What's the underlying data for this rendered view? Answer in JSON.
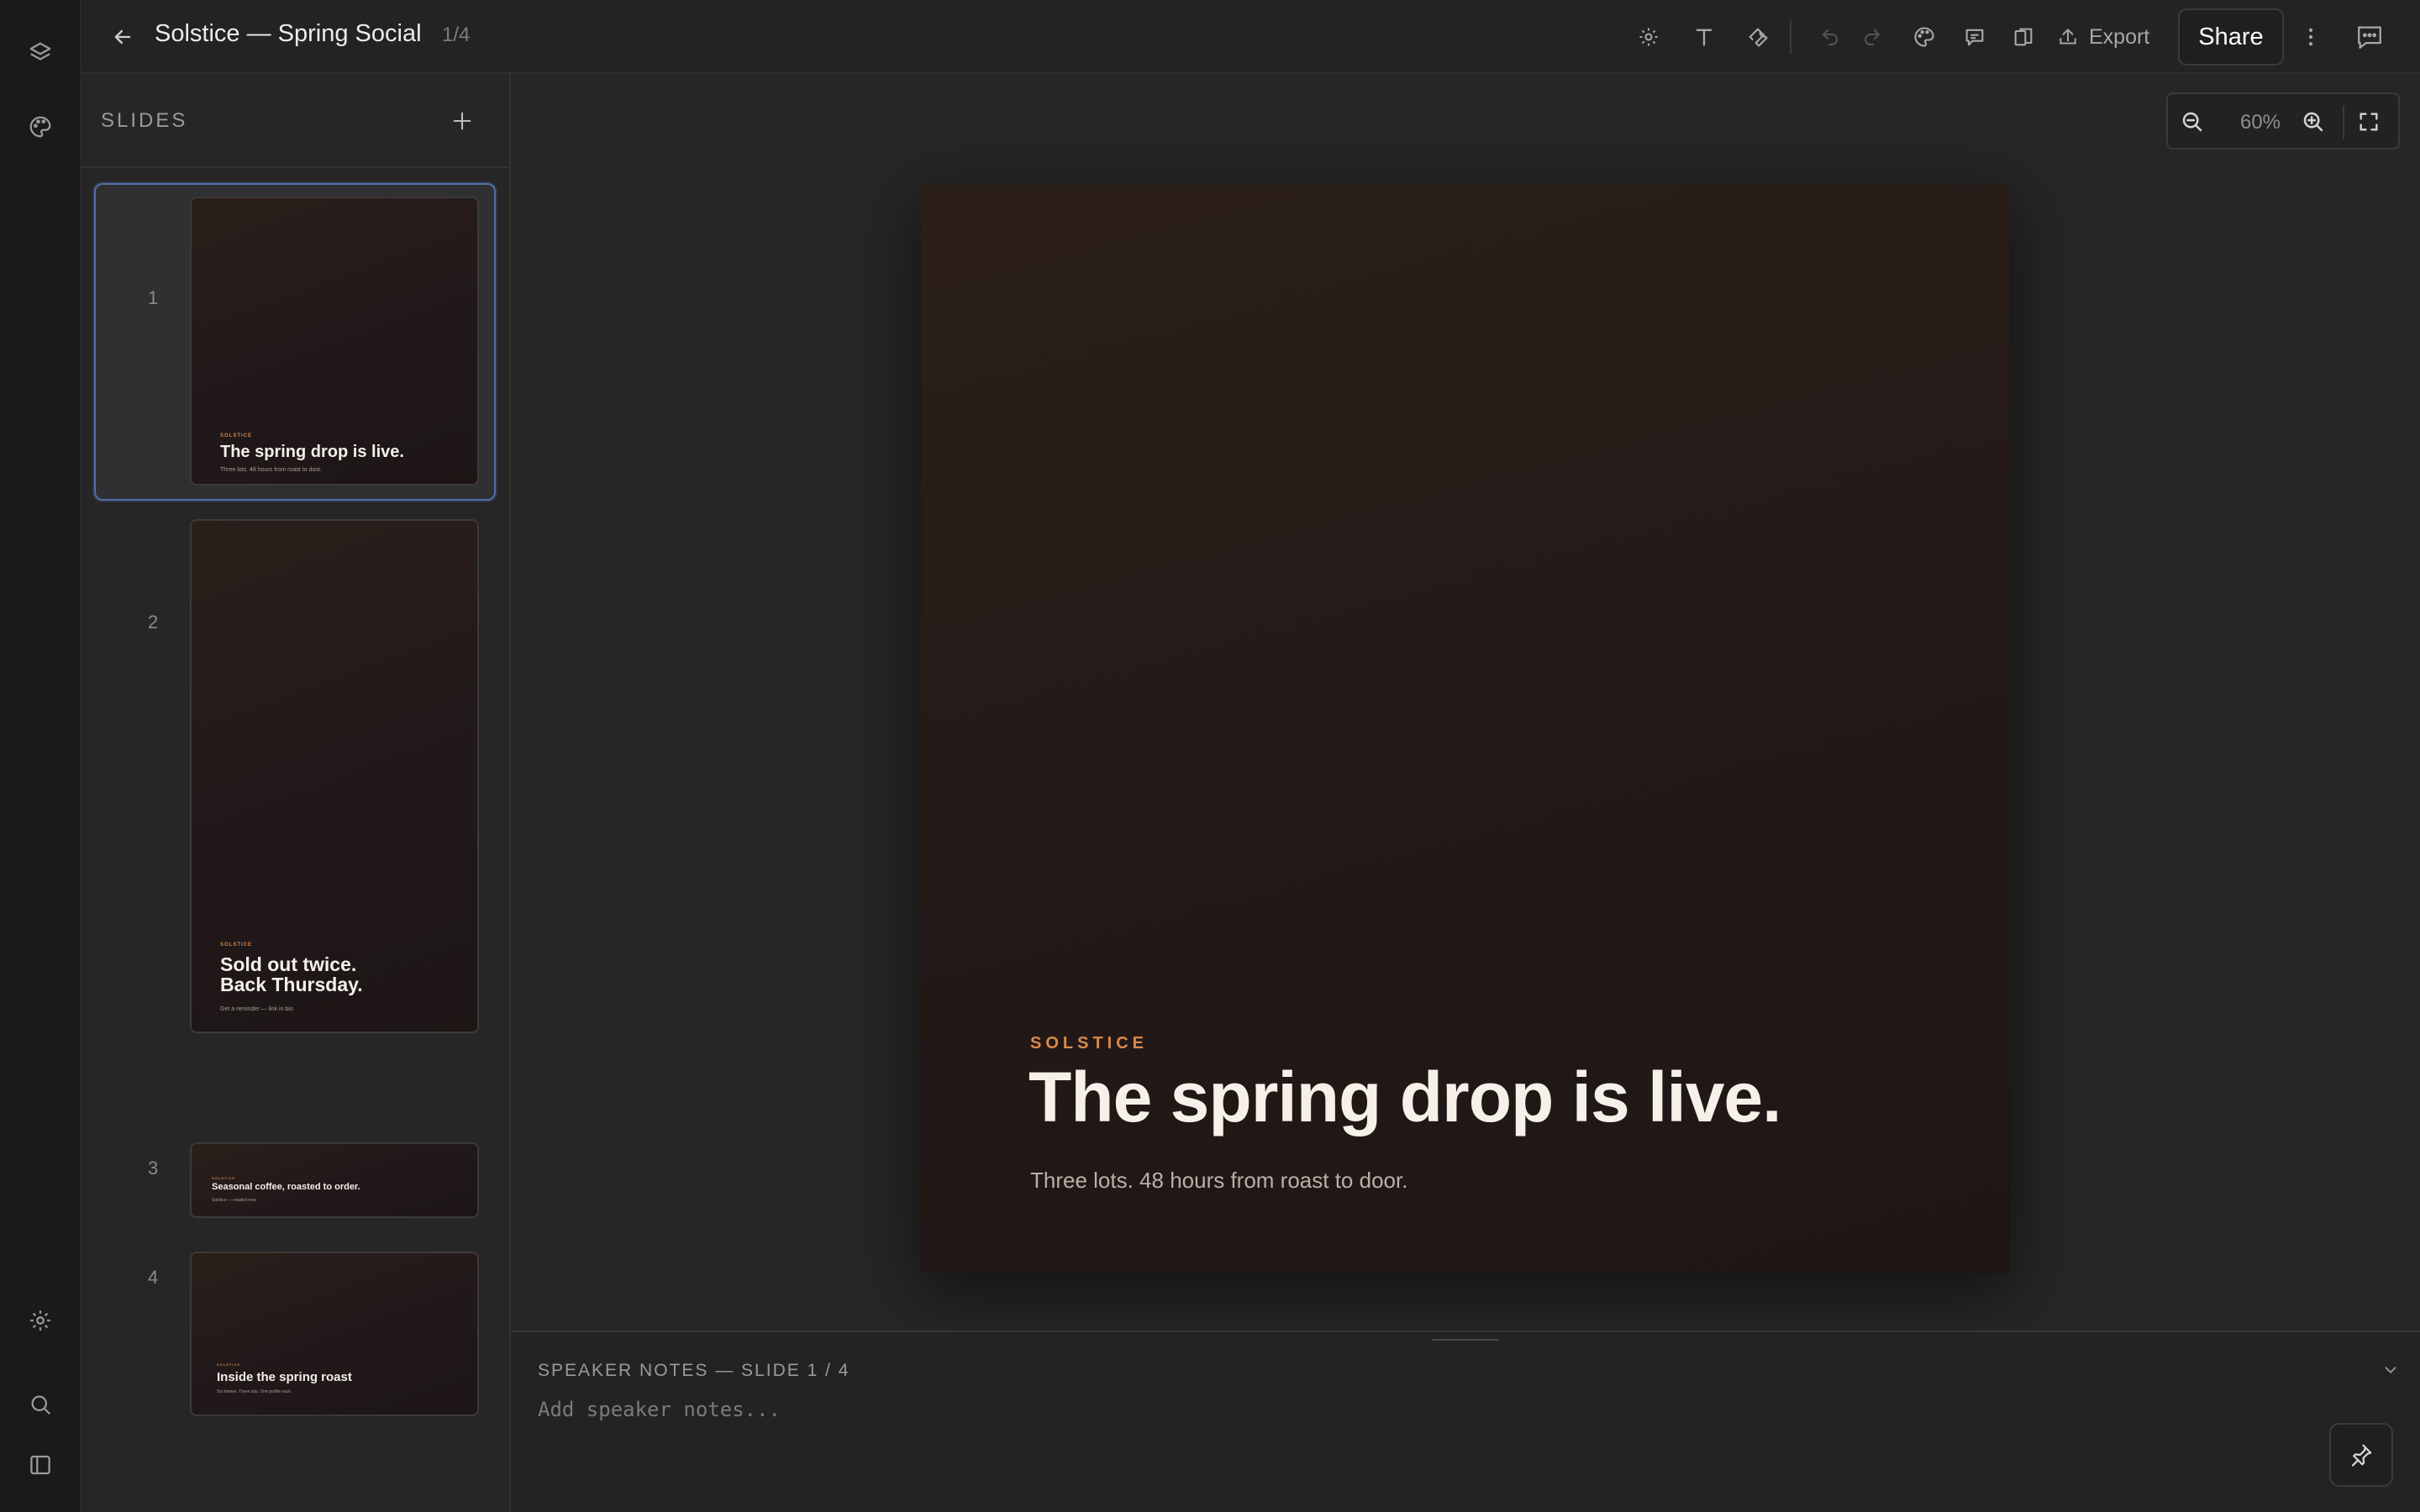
{
  "window": {
    "title": "Solstice — Spring Social",
    "page_count": "1/4"
  },
  "toolbar": {
    "export_label": "Export",
    "share_label": "Share",
    "icons": [
      "settings-icon",
      "text-icon",
      "wrench-icon",
      "undo-icon",
      "redo-icon",
      "palette-icon",
      "comment-icon",
      "layout-icon",
      "upload-icon",
      "more-icon",
      "chat-icon"
    ]
  },
  "rail": {
    "icons": [
      "layers-icon",
      "palette-icon",
      "settings-icon",
      "search-icon",
      "sidebar-toggle-icon"
    ]
  },
  "slides_panel": {
    "title": "SLIDES",
    "slides": [
      {
        "number": "1",
        "brand": "SOLSTICE",
        "headline": "The spring drop is live.",
        "sub": "Three lots. 48 hours from roast to door.",
        "selected": true
      },
      {
        "number": "2",
        "brand": "SOLSTICE",
        "headline": "Sold out twice.\nBack Thursday.",
        "sub": "Get a reminder — link in bio"
      },
      {
        "number": "3",
        "brand": "SOLSTICE",
        "headline": "Seasonal coffee, roasted to order.",
        "sub": "Solstice — roasted now"
      },
      {
        "number": "4",
        "brand": "SOLSTICE",
        "headline": "Inside the spring roast",
        "sub": "Six frames. Three lots. One profile each."
      }
    ]
  },
  "canvas": {
    "zoom_label": "60%",
    "slide": {
      "brand": "SOLSTICE",
      "headline": "The spring drop is live.",
      "sub": "Three lots. 48 hours from roast to door."
    }
  },
  "notes": {
    "title": "SPEAKER NOTES — SLIDE 1 / 4",
    "placeholder": "Add speaker notes...",
    "value": ""
  },
  "colors": {
    "accent": "#d9894b",
    "selection": "#4f6fa8",
    "background": "#232323",
    "slide_bg": "#241a18"
  }
}
